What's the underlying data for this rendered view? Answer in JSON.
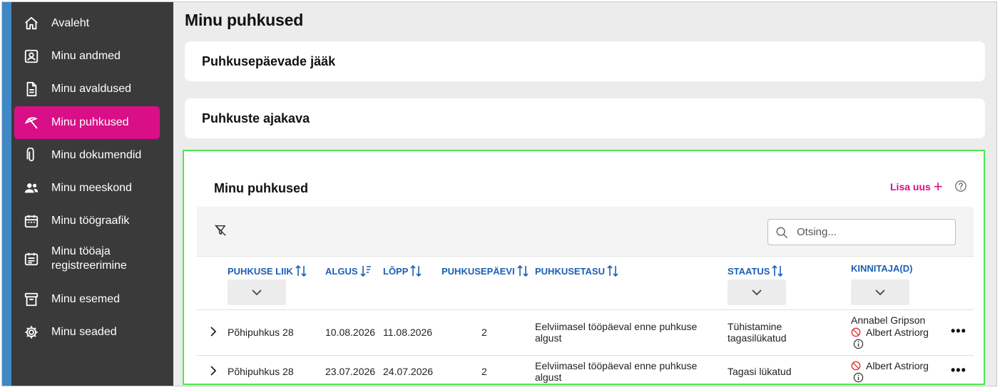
{
  "sidebar": {
    "items": [
      {
        "label": "Avaleht",
        "icon": "home-icon"
      },
      {
        "label": "Minu andmed",
        "icon": "id-card-icon"
      },
      {
        "label": "Minu avaldused",
        "icon": "document-icon"
      },
      {
        "label": "Minu puhkused",
        "icon": "beach-umbrella-icon",
        "active": true
      },
      {
        "label": "Minu dokumendid",
        "icon": "paperclip-icon"
      },
      {
        "label": "Minu meeskond",
        "icon": "team-icon"
      },
      {
        "label": "Minu töögraafik",
        "icon": "calendar-icon"
      },
      {
        "label": "Minu tööaja registreerimine",
        "icon": "calendar-list-icon"
      },
      {
        "label": "Minu esemed",
        "icon": "archive-box-icon"
      },
      {
        "label": "Minu seaded",
        "icon": "gear-icon"
      }
    ]
  },
  "main": {
    "page_title": "Minu puhkused",
    "cards": {
      "balance_title": "Puhkusepäevade jääk",
      "schedule_title": "Puhkuste ajakava"
    },
    "panel": {
      "title": "Minu puhkused",
      "add_new_label": "Lisa uus",
      "search_placeholder": "Otsing...",
      "columns": [
        {
          "key": "type",
          "label": "PUHKUSE LIIK",
          "sort": "both",
          "filter": true
        },
        {
          "key": "start",
          "label": "ALGUS",
          "sort": "desc",
          "filter": false
        },
        {
          "key": "end",
          "label": "LÕPP",
          "sort": "both",
          "filter": false
        },
        {
          "key": "days",
          "label": "PUHKUSEPÄEVI",
          "sort": "both",
          "filter": false
        },
        {
          "key": "pay",
          "label": "PUHKUSETASU",
          "sort": "both",
          "filter": false
        },
        {
          "key": "status",
          "label": "STAATUS",
          "sort": "both",
          "filter": true
        },
        {
          "key": "approvers",
          "label": "KINNITAJA(D)",
          "sort": "none",
          "filter": true
        }
      ],
      "rows": [
        {
          "type": "Põhipuhkus 28",
          "start": "10.08.2026",
          "end": "11.08.2026",
          "days": "2",
          "pay_line1": "Eelviimasel tööpäeval enne puhkuse",
          "pay_line2": "algust",
          "status_line1": "Tühistamine",
          "status_line2": "tagasilükatud",
          "approver_ok": "Annabel Gripson",
          "approver_rejected": "Albert Astriorg"
        },
        {
          "type": "Põhipuhkus 28",
          "start": "23.07.2026",
          "end": "24.07.2026",
          "days": "2",
          "pay_line1": "Eelviimasel tööpäeval enne puhkuse",
          "pay_line2": "algust",
          "status_line1": "Tagasi lükatud",
          "status_line2": "",
          "approver_ok": "",
          "approver_rejected": "Albert Astriorg"
        }
      ]
    }
  },
  "colors": {
    "sidebar_bg": "#3a3a3a",
    "sidebar_stripe": "#3f88c5",
    "accent": "#d80f86",
    "link_blue": "#1b5fb4",
    "rejected_red": "#e0343a",
    "focus_outline": "#4ee84e"
  }
}
